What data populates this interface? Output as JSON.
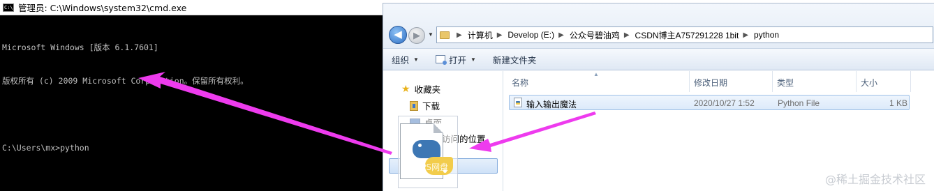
{
  "cmd": {
    "title": "管理员: C:\\Windows\\system32\\cmd.exe",
    "icon_text": "C:\\",
    "lines": [
      "Microsoft Windows [版本 6.1.7601]",
      "版权所有 (c) 2009 Microsoft Corporation。保留所有权利。",
      "",
      "C:\\Users\\mx>python"
    ]
  },
  "explorer": {
    "breadcrumbs": [
      "计算机",
      "Develop (E:)",
      "公众号碧油鸡",
      "CSDN博主A757291228 1bit",
      "python"
    ],
    "toolbar": {
      "organize": "组织",
      "open": "打开",
      "new_folder": "新建文件夹"
    },
    "nav_items": [
      "收藏夹",
      "下载",
      "桌面",
      "最近访问的位置"
    ],
    "columns": {
      "name": "名称",
      "modified": "修改日期",
      "type": "类型",
      "size": "大小"
    },
    "files": [
      {
        "name": "输入输出魔法",
        "modified": "2020/10/27 1:52",
        "type": "Python File",
        "size": "1 KB"
      }
    ]
  },
  "drag_ghost": {
    "label": "VPS网盘"
  },
  "watermark": "@稀土掘金技术社区",
  "colors": {
    "arrow": "#ee3bee",
    "cmd_bg": "#000000",
    "cmd_text": "#c0c0c0"
  },
  "icons": [
    "cmd-icon",
    "back-arrow-icon",
    "forward-arrow-icon",
    "folder-icon",
    "open-icon",
    "star-icon",
    "download-folder-icon",
    "desktop-icon",
    "python-file-icon",
    "python-logo-icon"
  ]
}
